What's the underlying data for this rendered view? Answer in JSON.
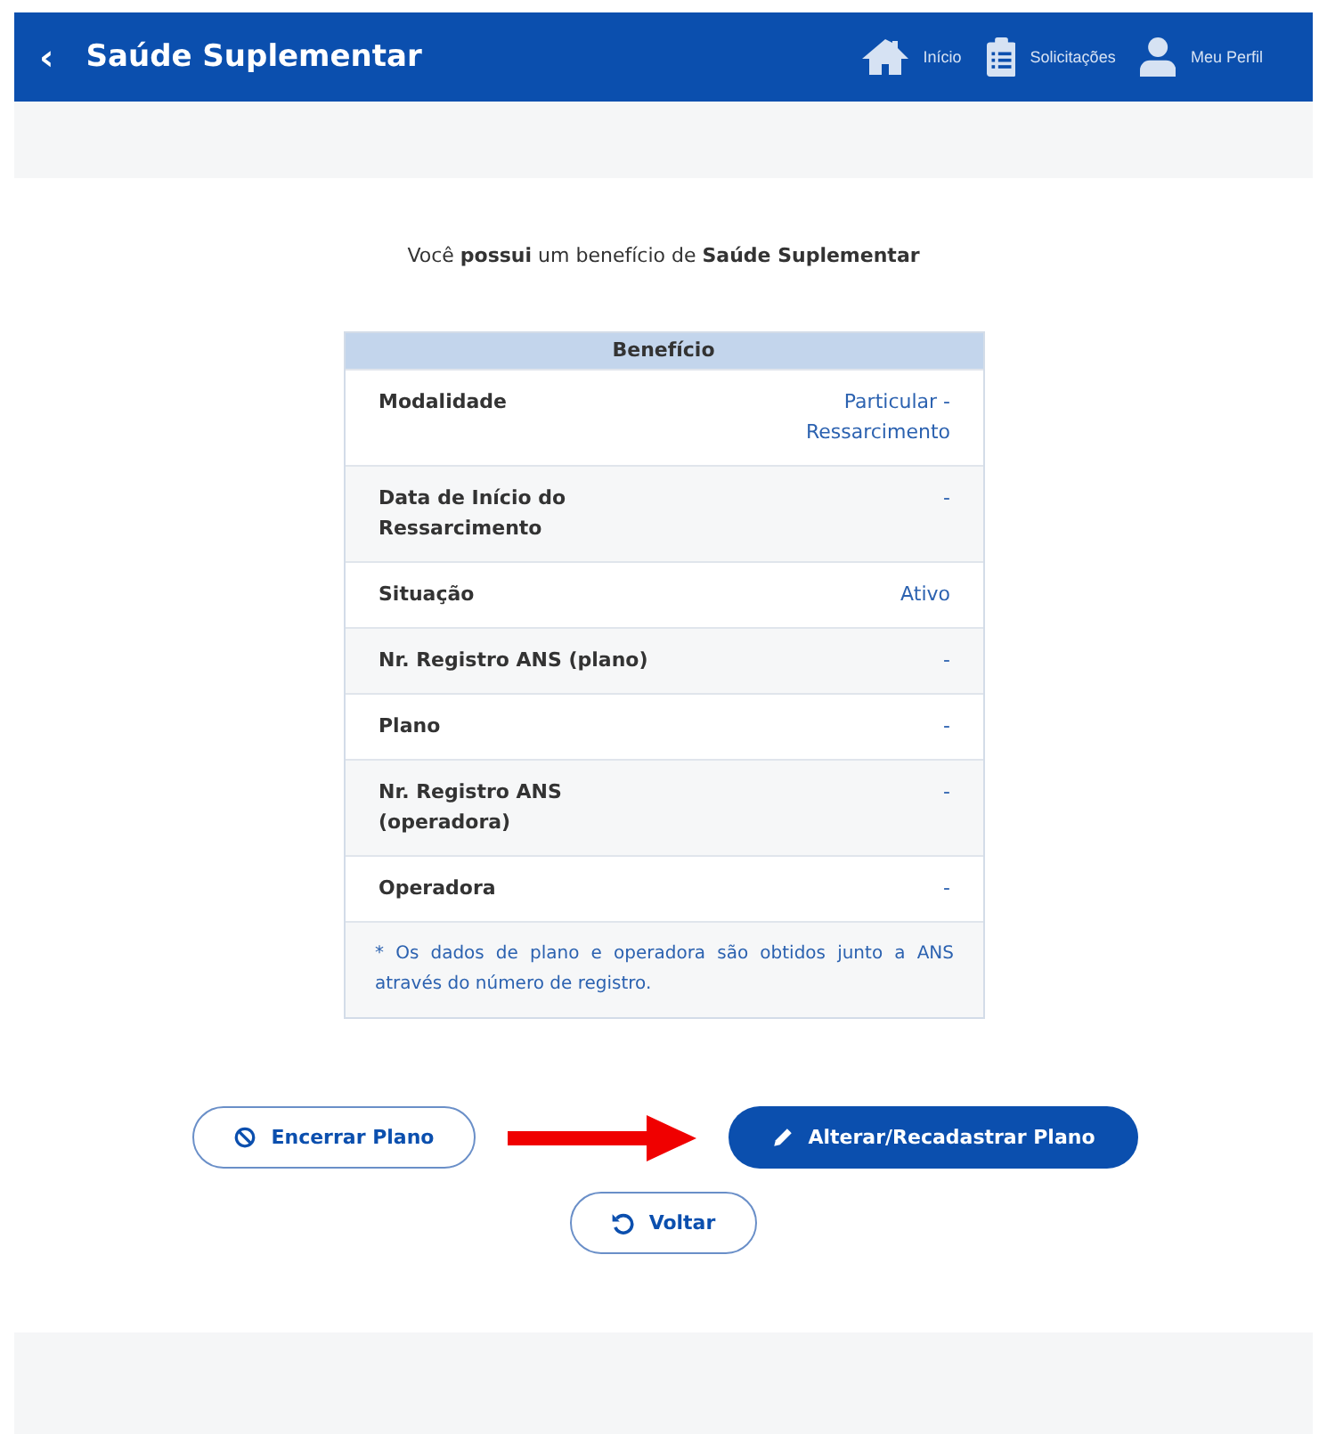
{
  "header": {
    "back": "‹",
    "title": "Saúde Suplementar",
    "nav": [
      {
        "kind": "home",
        "label": "Início"
      },
      {
        "kind": "clipboard",
        "label": "Solicitações"
      },
      {
        "kind": "user",
        "label": "Meu Perfil"
      }
    ]
  },
  "intro": "Você **possui** um benefício de **Saúde Suplementar**",
  "table": {
    "heading": "Benefício",
    "rows": [
      {
        "label": "Modalidade",
        "value": "Particular - Ressarcimento"
      },
      {
        "label": "Data de Início do Ressarcimento",
        "value": "-"
      },
      {
        "label": "Situação",
        "value": "Ativo"
      },
      {
        "label": "Nr. Registro ANS (plano)",
        "value": "-"
      },
      {
        "label": "Plano",
        "value": "-"
      },
      {
        "label": "Nr. Registro ANS (operadora)",
        "value": "-"
      },
      {
        "label": "Operadora",
        "value": "-"
      }
    ],
    "note": "* Os dados de plano e operadora são obtidos junto a ANS através do número de registro."
  },
  "buttons": [
    {
      "kind": "end",
      "label": "Encerrar Plano"
    },
    {
      "kind": "edit",
      "label": "Alterar/Recadastrar Plano"
    },
    {
      "kind": "back",
      "label": "Voltar"
    }
  ]
}
